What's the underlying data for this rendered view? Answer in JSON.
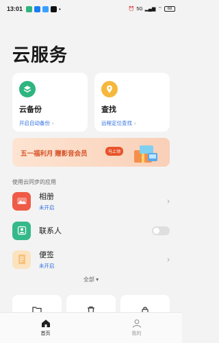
{
  "status_bar": {
    "time": "13:01",
    "network": "5G",
    "battery": "68"
  },
  "page": {
    "title": "云服务"
  },
  "cards": [
    {
      "title": "云备份",
      "subtitle": "开启自动备份",
      "icon": "cloud-backup-icon",
      "color": "#2fb57f"
    },
    {
      "title": "查找",
      "subtitle": "远程定位查找",
      "icon": "location-pin-icon",
      "color": "#f5b83d"
    }
  ],
  "banner": {
    "text": "五一福利月 赠影音会员",
    "button": "马上领"
  },
  "apps_section": {
    "label": "使用云同步的应用",
    "items": [
      {
        "title": "相册",
        "status": "未开启",
        "icon": "album-icon",
        "color": "#ef5b46"
      },
      {
        "title": "联系人",
        "status": "",
        "icon": "contacts-icon",
        "color": "#35b98a"
      },
      {
        "title": "便签",
        "status": "未开启",
        "icon": "notes-icon",
        "color": "#f6c27a"
      }
    ],
    "expand_label": "全部"
  },
  "bottom_nav": {
    "home_label": "首页",
    "mine_label": "我的"
  },
  "colors": {
    "accent": "#2f6fe0",
    "background": "#f3f3f3"
  }
}
